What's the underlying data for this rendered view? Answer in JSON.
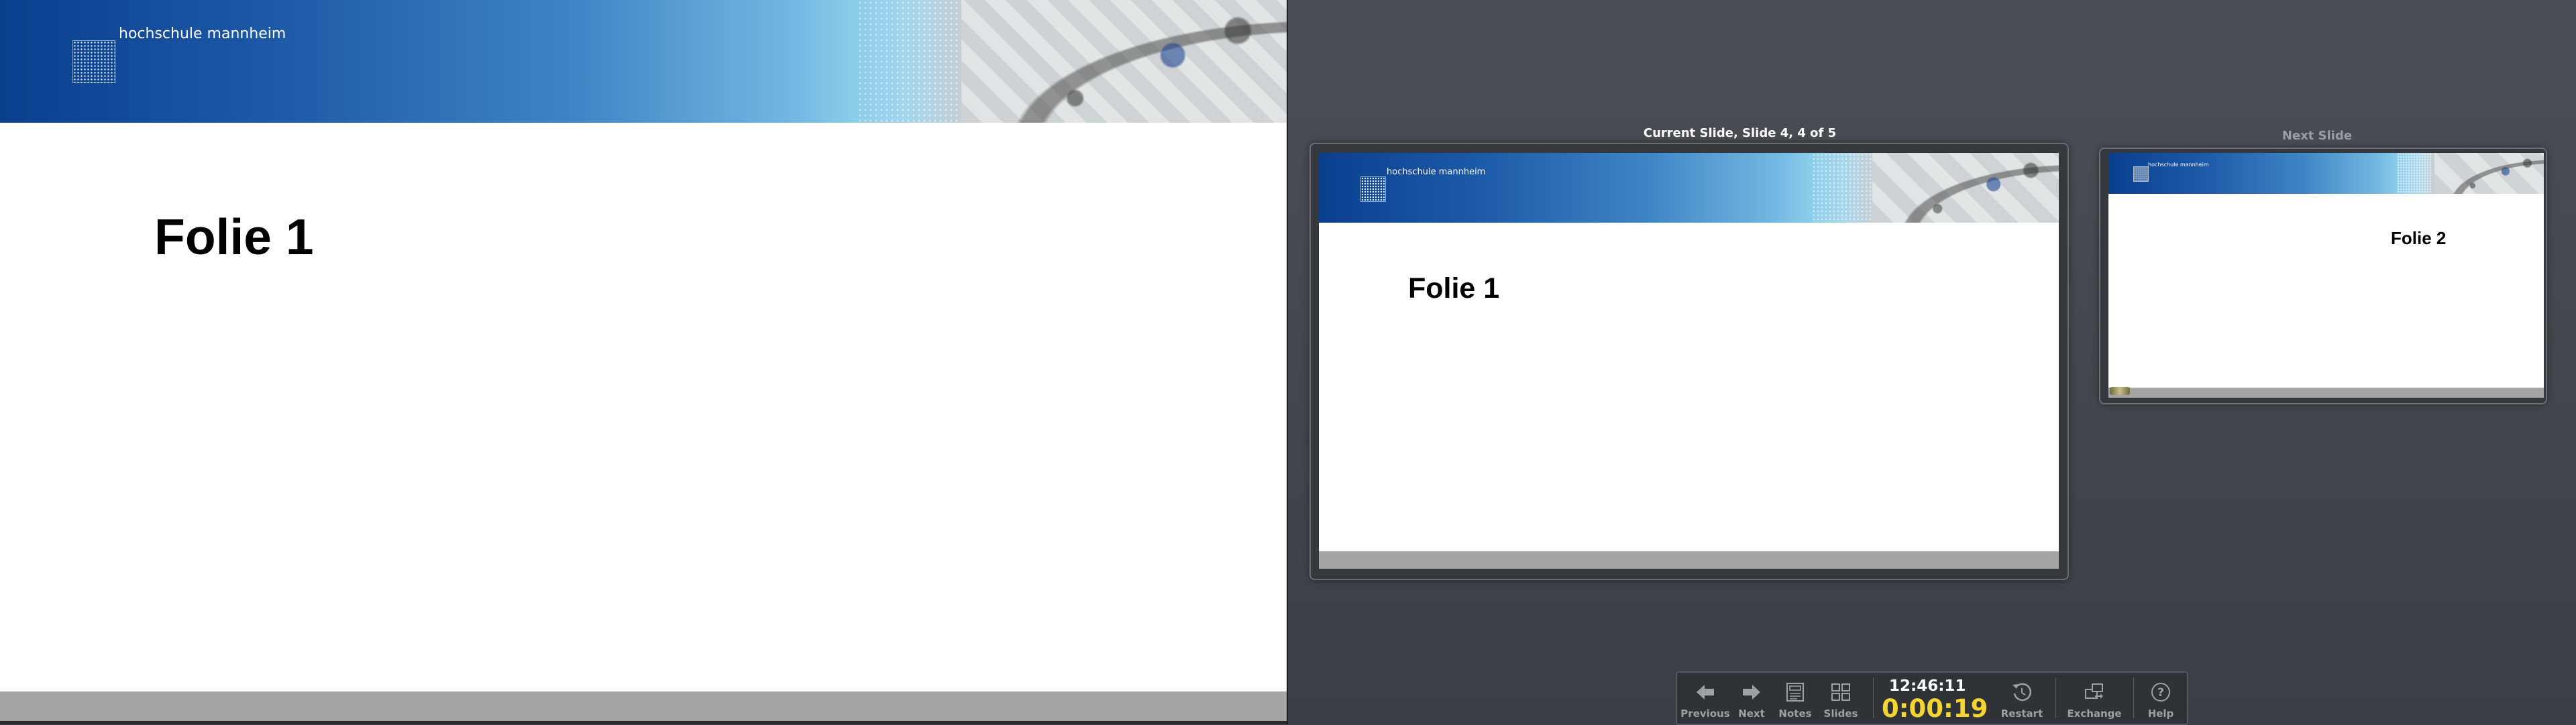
{
  "main_slide": {
    "logo_text": "hochschule mannheim",
    "title": "Folie 1"
  },
  "presenter": {
    "current_label": "Current Slide, Slide 4, 4 of 5",
    "next_label": "Next Slide",
    "current_slide": {
      "logo_text": "hochschule mannheim",
      "title": "Folie 1"
    },
    "next_slide": {
      "logo_text": "hochschule mannheim",
      "title": "Folie 2"
    }
  },
  "toolbar": {
    "previous_label": "Previous",
    "next_label": "Next",
    "notes_label": "Notes",
    "slides_label": "Slides",
    "clock": "12:46:11",
    "timer": "0:00:19",
    "restart_label": "Restart",
    "exchange_label": "Exchange",
    "help_label": "Help"
  },
  "icons": {
    "previous": "arrow-left-icon",
    "next": "arrow-right-icon",
    "notes": "notes-icon",
    "slides": "slides-grid-icon",
    "restart": "restart-icon",
    "exchange": "exchange-icon",
    "help": "help-icon"
  },
  "colors": {
    "timer": "#f4d532",
    "banner_start": "#0a3f8e",
    "banner_mid": "#73b9e2",
    "console_bg": "#3d4147"
  }
}
